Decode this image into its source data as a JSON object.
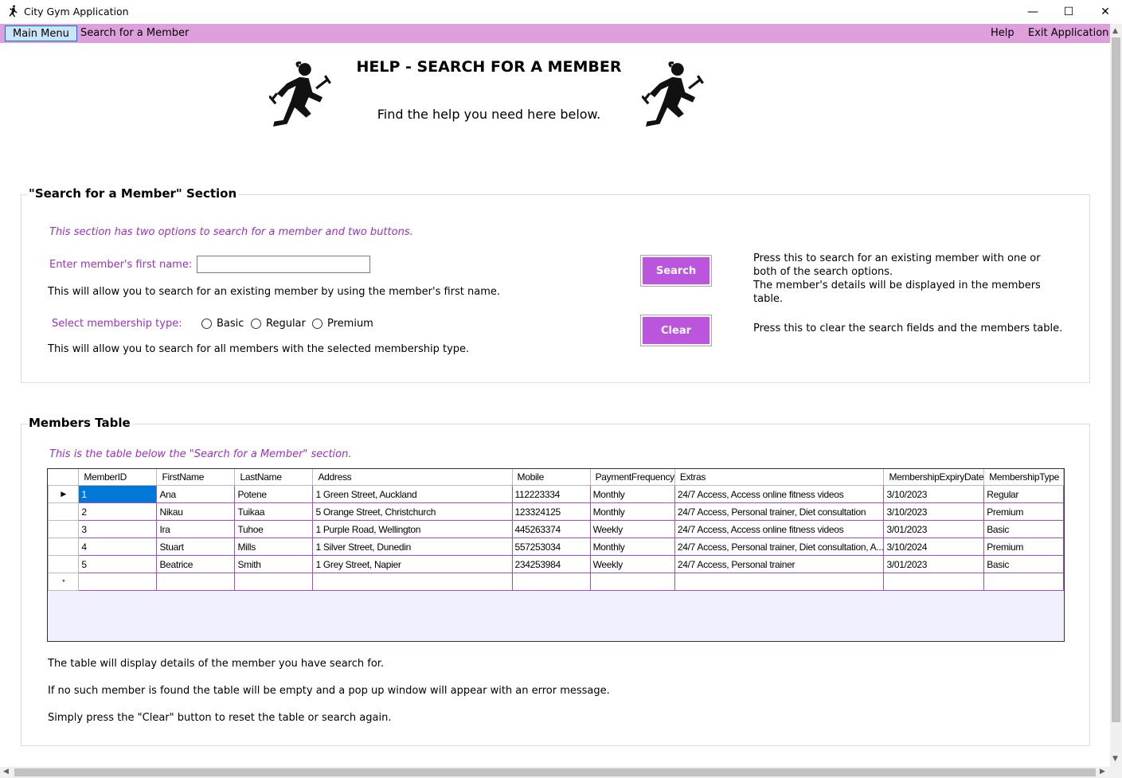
{
  "window": {
    "title": "City Gym Application",
    "controls": {
      "minimize": "—",
      "maximize": "☐",
      "close": "✕"
    }
  },
  "menu": {
    "main_menu": "Main Menu",
    "search_member": "Search for a Member",
    "help": "Help",
    "exit": "Exit Application"
  },
  "header": {
    "title": "HELP - SEARCH FOR A MEMBER",
    "subtitle": "Find the help you need here below."
  },
  "search_section": {
    "title": "\"Search for a Member\" Section",
    "intro": "This section has two options to search for a member and two buttons.",
    "firstname_label": "Enter member's first name:",
    "firstname_value": "",
    "firstname_help": "This will allow you to search for an existing member by using the member's first name.",
    "membership_label": "Select membership type:",
    "membership_options": [
      "Basic",
      "Regular",
      "Premium"
    ],
    "membership_help": "This will allow you to search for all members with the selected membership type.",
    "search_button": "Search",
    "search_help_1": "Press this to search for an existing member with one or both of the search options.",
    "search_help_2": "The member's details will be displayed in the members table.",
    "clear_button": "Clear",
    "clear_help": "Press this to clear the search fields and the members table."
  },
  "members_section": {
    "title": "Members Table",
    "intro": "This is the table below the \"Search for a Member\" section.",
    "columns": [
      "MemberID",
      "FirstName",
      "LastName",
      "Address",
      "Mobile",
      "PaymentFrequency",
      "Extras",
      "MembershipExpiryDate",
      "MembershipType"
    ],
    "rows": [
      [
        "1",
        "Ana",
        "Potene",
        "1 Green Street, Auckland",
        "112223334",
        "Monthly",
        "24/7 Access, Access online fitness videos",
        "3/10/2023",
        "Regular"
      ],
      [
        "2",
        "Nikau",
        "Tuikaa",
        "5 Orange Street, Christchurch",
        "123324125",
        "Monthly",
        "24/7 Access, Personal trainer, Diet consultation",
        "3/10/2023",
        "Premium"
      ],
      [
        "3",
        "Ira",
        "Tuhoe",
        "1 Purple Road, Wellington",
        "445263374",
        "Weekly",
        "24/7 Access, Access online fitness videos",
        "3/01/2023",
        "Basic"
      ],
      [
        "4",
        "Stuart",
        "Mills",
        "1 Silver Street, Dunedin",
        "557253034",
        "Monthly",
        "24/7 Access, Personal trainer, Diet consultation, A...",
        "3/10/2024",
        "Premium"
      ],
      [
        "5",
        "Beatrice",
        "Smith",
        "1 Grey Street, Napier",
        "234253984",
        "Weekly",
        "24/7 Access, Personal trainer",
        "3/01/2023",
        "Basic"
      ]
    ],
    "current_row_marker": "▶",
    "new_row_marker": "*",
    "note_1": "The table will display details of the member you have search for.",
    "note_2": "If no such member is found the table will be empty and a pop up window will appear with an error message.",
    "note_3": "Simply press the \"Clear\" button to reset the table or search again."
  },
  "icons": {
    "app": "runner-icon",
    "header_left": "runner-icon",
    "header_right": "runner-icon"
  },
  "colors": {
    "menu_bar": "#dda0dd",
    "button": "#bb55dd",
    "accent_text": "#9b30c0",
    "selection": "#0078d7"
  }
}
